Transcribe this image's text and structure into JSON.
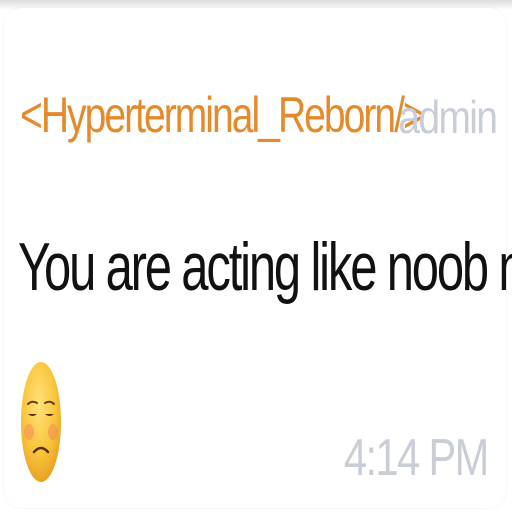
{
  "message": {
    "sender_name": "<Hyperterminal_Reborn/>",
    "role_tag": "admin",
    "text": "You are acting like noob now",
    "emoji_icon": "unamused-face-icon",
    "timestamp": "4:14 PM"
  },
  "colors": {
    "sender_name": "#e58a2b",
    "role_tag": "#c9ced6",
    "text": "#111111",
    "timestamp": "#c9ced6",
    "background": "#ffffff"
  }
}
